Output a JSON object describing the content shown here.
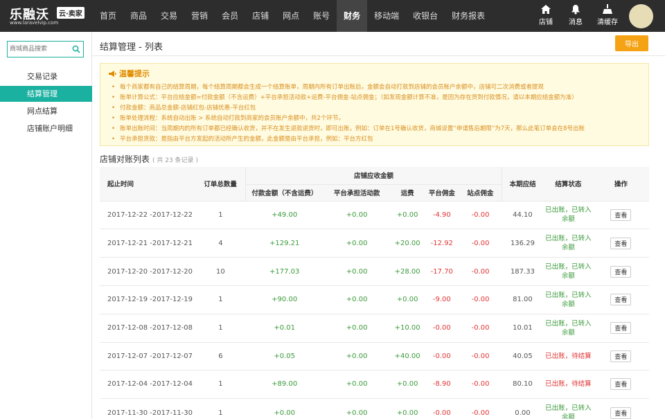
{
  "brand": {
    "name": "乐融沃",
    "badge": "云·卖家",
    "url": "www.laravelvip.com"
  },
  "nav": {
    "items": [
      "首页",
      "商品",
      "交易",
      "营销",
      "会员",
      "店铺",
      "网点",
      "账号",
      "财务",
      "移动端",
      "收银台",
      "财务报表"
    ],
    "active": "财务"
  },
  "quick_actions": {
    "store": "店铺",
    "message": "消息",
    "cache": "清缓存"
  },
  "sidebar": {
    "search_placeholder": "商城商品搜索",
    "items": [
      {
        "label": "交易记录"
      },
      {
        "label": "结算管理",
        "active": true
      },
      {
        "label": "网点结算"
      },
      {
        "label": "店铺账户明细"
      }
    ]
  },
  "page": {
    "title": "结算管理 - 列表",
    "export_label": "导出"
  },
  "tips": {
    "title": "温馨提示",
    "items": [
      "每个商家都有自己的结算周期，每个结算周期都会生成一个结算账单，周期内所有订单出账后，金额会自动打款到店铺的会员账户余额中，店铺可二次消费或者提现",
      "账单计算公式：平台应结金额=付款金额（不含运费）+平台承担活动款+运费-平台佣金-站点佣金；（如发现金额计算不准，是因为存在货到付款情况，请以本期应结金额为准）",
      "付款金额：商品总金额-店铺红包-店铺优惠-平台红包",
      "账单处理流程：系统自动出账 > 系统自动打款到商家的会员账户余额中，共2个环节。",
      "账单出账时间：当周期内的所有订单都已经确认收货，并不在发生退款退货时，即可出账，例如：订单在1号确认收货，商城设置“申请售后期限”为7天，那么此笔订单会在8号出账",
      "平台承担货款：是指由平台方发起的活动所产生的金额，此金额是由平台承担，例如：平台方红包"
    ]
  },
  "list": {
    "title": "店铺对账列表",
    "count_text": "( 共 23 条记录 )",
    "headers": {
      "period": "起止时间",
      "orders": "订单总数量",
      "group": "店铺应收金额",
      "pay": "付款金额（不含运费）",
      "platform": "平台承担活动款",
      "freight": "运费",
      "platform_fee": "平台佣金",
      "site_fee": "站点佣金",
      "due": "本期应结",
      "status": "结算状态",
      "action": "操作"
    },
    "view_label": "查看",
    "rows": [
      {
        "period": "2017-12-22 -2017-12-22",
        "orders": "1",
        "pay": "+49.00",
        "platform": "+0.00",
        "freight": "+0.00",
        "platform_fee": "-4.90",
        "site_fee": "-0.00",
        "due": "44.10",
        "status": "已出账，已转入余额",
        "status_color": "green"
      },
      {
        "period": "2017-12-21 -2017-12-21",
        "orders": "4",
        "pay": "+129.21",
        "platform": "+0.00",
        "freight": "+20.00",
        "platform_fee": "-12.92",
        "site_fee": "-0.00",
        "due": "136.29",
        "status": "已出账，已转入余额",
        "status_color": "green"
      },
      {
        "period": "2017-12-20 -2017-12-20",
        "orders": "10",
        "pay": "+177.03",
        "platform": "+0.00",
        "freight": "+28.00",
        "platform_fee": "-17.70",
        "site_fee": "-0.00",
        "due": "187.33",
        "status": "已出账，已转入余额",
        "status_color": "green"
      },
      {
        "period": "2017-12-19 -2017-12-19",
        "orders": "1",
        "pay": "+90.00",
        "platform": "+0.00",
        "freight": "+0.00",
        "platform_fee": "-9.00",
        "site_fee": "-0.00",
        "due": "81.00",
        "status": "已出账，已转入余额",
        "status_color": "green"
      },
      {
        "period": "2017-12-08 -2017-12-08",
        "orders": "1",
        "pay": "+0.01",
        "platform": "+0.00",
        "freight": "+10.00",
        "platform_fee": "-0.00",
        "site_fee": "-0.00",
        "due": "10.01",
        "status": "已出账，已转入余额",
        "status_color": "green"
      },
      {
        "period": "2017-12-07 -2017-12-07",
        "orders": "6",
        "pay": "+0.05",
        "platform": "+0.00",
        "freight": "+40.00",
        "platform_fee": "-0.00",
        "site_fee": "-0.00",
        "due": "40.05",
        "status": "已出账，待结算",
        "status_color": "red"
      },
      {
        "period": "2017-12-04 -2017-12-04",
        "orders": "1",
        "pay": "+89.00",
        "platform": "+0.00",
        "freight": "+0.00",
        "platform_fee": "-8.90",
        "site_fee": "-0.00",
        "due": "80.10",
        "status": "已出账，待结算",
        "status_color": "red"
      },
      {
        "period": "2017-11-30 -2017-11-30",
        "orders": "1",
        "pay": "+0.00",
        "platform": "+0.00",
        "freight": "+0.00",
        "platform_fee": "-0.00",
        "site_fee": "-0.00",
        "due": "0.00",
        "status": "已出账，已转入余额",
        "status_color": "green"
      }
    ]
  }
}
